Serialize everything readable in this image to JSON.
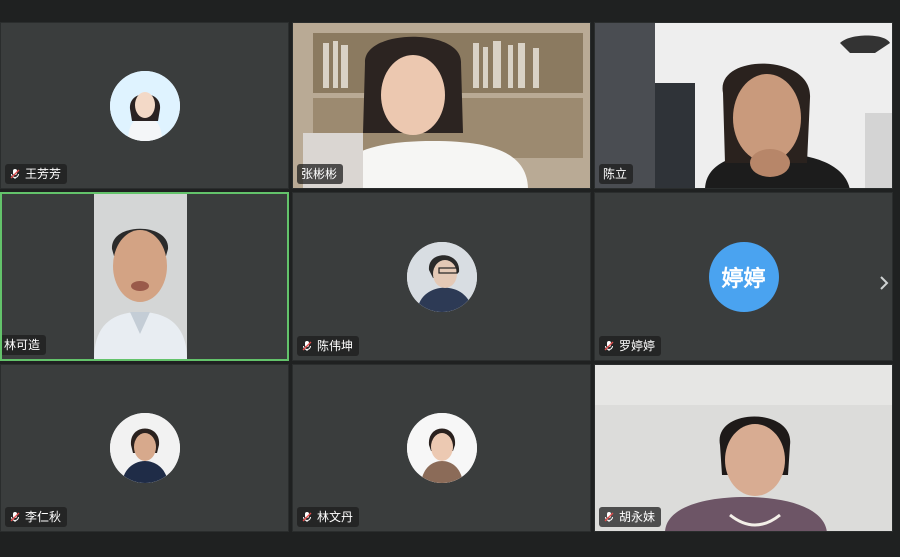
{
  "participants": [
    {
      "name": "王芳芳",
      "kind": "avatar-photo",
      "mic": "muted-icon"
    },
    {
      "name": "张彬彬",
      "kind": "video"
    },
    {
      "name": "陈立",
      "kind": "video"
    },
    {
      "name": "林可造",
      "kind": "video",
      "active": true
    },
    {
      "name": "陈伟坤",
      "kind": "avatar-photo",
      "mic": "muted-icon"
    },
    {
      "name": "罗婷婷",
      "kind": "avatar-text",
      "avatar_text": "婷婷",
      "mic": "muted-icon"
    },
    {
      "name": "李仁秋",
      "kind": "avatar-photo",
      "mic": "muted-icon"
    },
    {
      "name": "林文丹",
      "kind": "avatar-photo",
      "mic": "muted-icon"
    },
    {
      "name": "胡永妹",
      "kind": "video",
      "mic": "muted-icon"
    }
  ],
  "colors": {
    "tile_bg": "#3a3d3d",
    "active_border": "#63c36b",
    "avatar_text_bg": "#4aa3f0"
  },
  "next_page_icon": "chevron-right-icon"
}
